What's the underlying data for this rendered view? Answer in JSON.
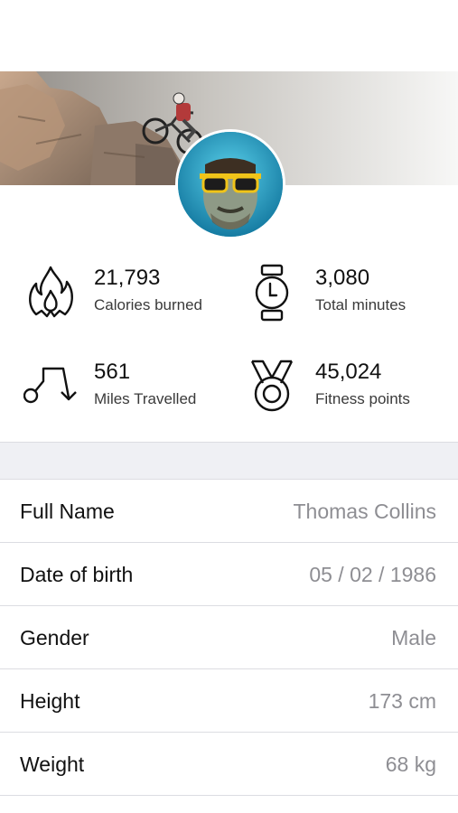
{
  "profile": {
    "cover_image": "mountain-biker-on-rocks",
    "avatar_image": "man-with-yellow-sunglasses-underwater"
  },
  "stats": [
    {
      "icon": "flame-icon",
      "value": "21,793",
      "label": "Calories burned"
    },
    {
      "icon": "watch-icon",
      "value": "3,080",
      "label": "Total minutes"
    },
    {
      "icon": "route-icon",
      "value": "561",
      "label": "Miles Travelled"
    },
    {
      "icon": "medal-icon",
      "value": "45,024",
      "label": "Fitness points"
    }
  ],
  "info": [
    {
      "label": "Full Name",
      "value": "Thomas Collins"
    },
    {
      "label": "Date of birth",
      "value": "05 / 02 / 1986"
    },
    {
      "label": "Gender",
      "value": "Male"
    },
    {
      "label": "Height",
      "value": "173 cm"
    },
    {
      "label": "Weight",
      "value": "68 kg"
    }
  ],
  "colors": {
    "primary_text": "#111111",
    "secondary_text": "#8e8e93",
    "separator_band": "#eff0f4",
    "divider": "#dcdde2"
  }
}
